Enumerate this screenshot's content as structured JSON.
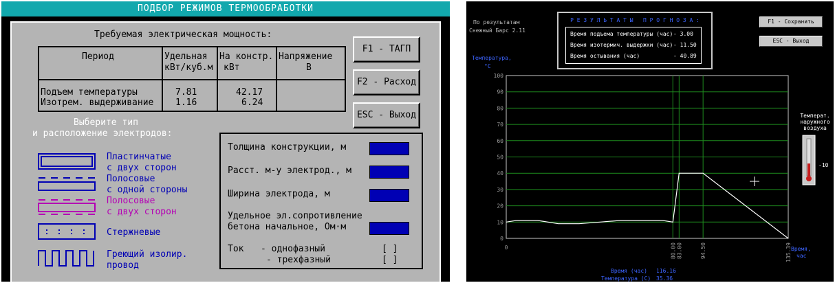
{
  "left": {
    "title": "ПОДБОР РЕЖИМОВ ТЕРМООБРАБОТКИ",
    "required_power_heading": "Требуемая электрическая мощность:",
    "table": {
      "headers": {
        "period": "Период",
        "specific_1": "Удельная",
        "specific_2": "кВт/куб.м",
        "construct_1": "На констр.",
        "construct_2": "кВт",
        "voltage_1": "Напряжение",
        "voltage_2": "В"
      },
      "rows": [
        {
          "period": "Подъем температуры",
          "specific": "7.81",
          "construct": "42.17",
          "voltage": ""
        },
        {
          "period": "Изотрем. выдерживание",
          "specific": "1.16",
          "construct": "6.24",
          "voltage": ""
        }
      ]
    },
    "buttons": {
      "f1": "F1 - ТАГП",
      "f2": "F2 - Расход",
      "esc": "ESC - Выход"
    },
    "electrode_prompt_1": "Выберите тип",
    "electrode_prompt_2": "и расположение электродов:",
    "electrodes": {
      "plate_1": "Пластинчатые",
      "plate_2": "с двух сторон",
      "strip1_1": "Полосовые",
      "strip1_2": "с одной стороны",
      "strip2_1": "Полосовые",
      "strip2_2": "с двух сторон",
      "rod": "Стержневые",
      "wire_1": "Греющий изолир.",
      "wire_2": "провод"
    },
    "params": {
      "thickness": "Толщина конструкции, м",
      "distance": "Расст. м-у электрод., м",
      "width": "Ширина электрода, м",
      "resistivity_1": "Удельное эл.сопротивление",
      "resistivity_2": "бетона начальное, Ом·м",
      "current_label": "Ток",
      "single_phase": "- однофазный",
      "three_phase": "- трехфазный",
      "checkbox": "[ ]"
    },
    "colors": {
      "titlebar": "#12a8ad",
      "panel": "#b4b4b4",
      "field": "#0000b4",
      "pink": "#b400b4"
    }
  },
  "right": {
    "source_1": "По результатам",
    "source_2": "Снежный Барс 2.11",
    "forecast_title": "Р Е З У Л Ь Т А Т Ы   П Р О Г Н О З А :",
    "forecast": [
      {
        "label": "Время подъема температуры (час)",
        "value": "- 3.00"
      },
      {
        "label": "Время изотермич. выдержки (час)",
        "value": "- 11.50"
      },
      {
        "label": "Время остывания (час)",
        "value": "- 40.89"
      }
    ],
    "buttons": {
      "save": "F1 - Сохранить",
      "exit": "ESC - Выход"
    },
    "ylabel_1": "Температура,",
    "ylabel_2": "°С",
    "xlabel_1": "Время,",
    "xlabel_2": "час",
    "outside_temp_1": "Температ.",
    "outside_temp_2": "наружного",
    "outside_temp_3": "воздуха",
    "thermo_value": "-10",
    "cursor_time_label": "Время (час)",
    "cursor_time_value": "116.16",
    "cursor_temp_label": "Температура (С)",
    "cursor_temp_value": "35.36",
    "colors": {
      "grid": "#1e8c1e",
      "curve": "#ffffff",
      "accent": "#3c64ff"
    }
  },
  "chart_data": {
    "type": "line",
    "xlabel": "Время, час",
    "ylabel": "Температура, °С",
    "ylim": [
      0,
      100
    ],
    "xlim": [
      0,
      135.39
    ],
    "y_ticks": [
      0,
      10,
      20,
      30,
      40,
      50,
      60,
      70,
      80,
      90,
      100
    ],
    "x_ticks": [
      "0",
      "80.00",
      "83.00",
      "94.50",
      "135.39"
    ],
    "x_tick_values": [
      0,
      80.0,
      83.0,
      94.5,
      135.39
    ],
    "grid": true,
    "series": [
      {
        "values_x": [
          0,
          5,
          15,
          25,
          35,
          45,
          55,
          65,
          75,
          80,
          83,
          94.5,
          135.39
        ],
        "values_y": [
          10,
          11,
          11,
          9,
          9,
          10,
          11,
          11,
          11,
          10,
          40,
          40,
          0
        ]
      }
    ]
  }
}
